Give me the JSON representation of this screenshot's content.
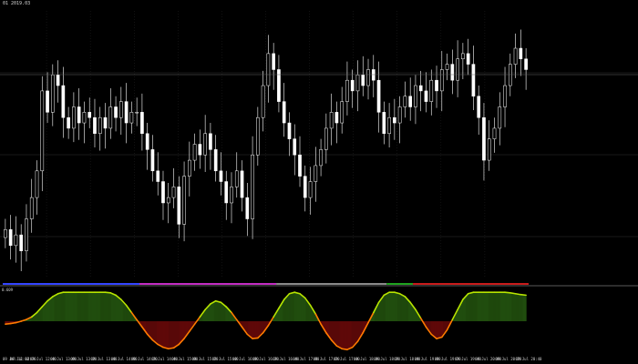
{
  "window": {
    "symbol_caption": "01 2019.03"
  },
  "indicator": {
    "caption": "0.609"
  },
  "colors": {
    "background": "#000000",
    "grid": "#3a3a3a",
    "candle": "#ffffff",
    "session_bar_blue": "#3344ff",
    "session_bar_magenta": "#c22cc2",
    "session_bar_gray": "#8a8a8a",
    "session_bar_green": "#1fa31f",
    "session_bar_red": "#c81b1b",
    "osc_up": "#b7e400",
    "osc_down": "#ff7a00",
    "hist_up": "#3d8f1a",
    "hist_down": "#b01010"
  },
  "chart_data": {
    "type": "candlestick",
    "price_ylim": [
      0,
      100
    ],
    "price_closes": [
      18,
      12,
      16,
      10,
      22,
      30,
      40,
      70,
      62,
      76,
      72,
      60,
      56,
      64,
      58,
      62,
      60,
      54,
      60,
      56,
      64,
      60,
      66,
      58,
      62,
      62,
      54,
      48,
      40,
      36,
      28,
      30,
      34,
      20,
      38,
      44,
      50,
      46,
      54,
      48,
      40,
      36,
      28,
      34,
      40,
      30,
      22,
      46,
      60,
      72,
      84,
      78,
      66,
      58,
      52,
      46,
      38,
      30,
      36,
      42,
      48,
      56,
      62,
      58,
      66,
      74,
      70,
      76,
      72,
      78,
      74,
      62,
      54,
      60,
      58,
      64,
      68,
      64,
      72,
      70,
      66,
      74,
      70,
      78,
      80,
      74,
      82,
      84,
      80,
      68,
      60,
      44,
      52,
      56,
      64,
      72,
      80,
      86,
      82,
      78
    ],
    "oscillator": {
      "values": [
        -0.1,
        -0.08,
        -0.05,
        0.0,
        0.06,
        0.15,
        0.3,
        0.5,
        0.7,
        0.85,
        0.95,
        1.0,
        1.0,
        1.0,
        1.0,
        1.0,
        1.0,
        1.0,
        1.0,
        1.0,
        0.98,
        0.9,
        0.75,
        0.55,
        0.3,
        0.05,
        -0.2,
        -0.45,
        -0.65,
        -0.8,
        -0.9,
        -0.95,
        -0.92,
        -0.8,
        -0.6,
        -0.35,
        -0.1,
        0.15,
        0.4,
        0.6,
        0.7,
        0.65,
        0.5,
        0.3,
        0.05,
        -0.2,
        -0.45,
        -0.6,
        -0.58,
        -0.4,
        -0.15,
        0.15,
        0.45,
        0.75,
        0.95,
        1.0,
        0.95,
        0.8,
        0.55,
        0.25,
        -0.1,
        -0.4,
        -0.65,
        -0.85,
        -0.95,
        -0.98,
        -0.9,
        -0.7,
        -0.4,
        -0.05,
        0.3,
        0.65,
        0.9,
        1.0,
        1.0,
        0.95,
        0.85,
        0.65,
        0.4,
        0.1,
        -0.2,
        -0.45,
        -0.6,
        -0.55,
        -0.3,
        0.05,
        0.4,
        0.75,
        0.95,
        1.0,
        1.0,
        1.0,
        1.0,
        1.0,
        1.0,
        1.0,
        0.98,
        0.95,
        0.92,
        0.9
      ],
      "ylim": [
        -1.1,
        1.1
      ]
    },
    "session_segments": [
      {
        "name": "",
        "color": "#3344ff",
        "from": 0.0,
        "to": 0.26
      },
      {
        "name": "",
        "color": "#c22cc2",
        "from": 0.26,
        "to": 0.52
      },
      {
        "name": "",
        "color": "#8a8a8a",
        "from": 0.52,
        "to": 0.73
      },
      {
        "name": "",
        "color": "#1fa31f",
        "from": 0.73,
        "to": 0.78
      },
      {
        "name": "",
        "color": "#c81b1b",
        "from": 0.78,
        "to": 1.0
      }
    ],
    "time_labels": [
      "09 Jul 12:00",
      "09 Jul 12:20",
      "09 Jul 12:40",
      "09 Jul 13:00",
      "09 Jul 13:20",
      "09 Jul 13:40",
      "09 Jul 14:00",
      "09 Jul 14:20",
      "09 Jul 14:40",
      "09 Jul 15:00",
      "09 Jul 15:20",
      "09 Jul 15:40",
      "09 Jul 16:00",
      "09 Jul 16:20",
      "09 Jul 16:40",
      "09 Jul 17:00",
      "09 Jul 17:20",
      "09 Jul 17:40",
      "09 Jul 18:00",
      "09 Jul 18:20",
      "09 Jul 18:40",
      "09 Jul 19:00",
      "09 Jul 19:20",
      "09 Jul 19:40",
      "09 Jul 20:00",
      "09 Jul 20:20",
      "09 Jul 20:40"
    ]
  }
}
